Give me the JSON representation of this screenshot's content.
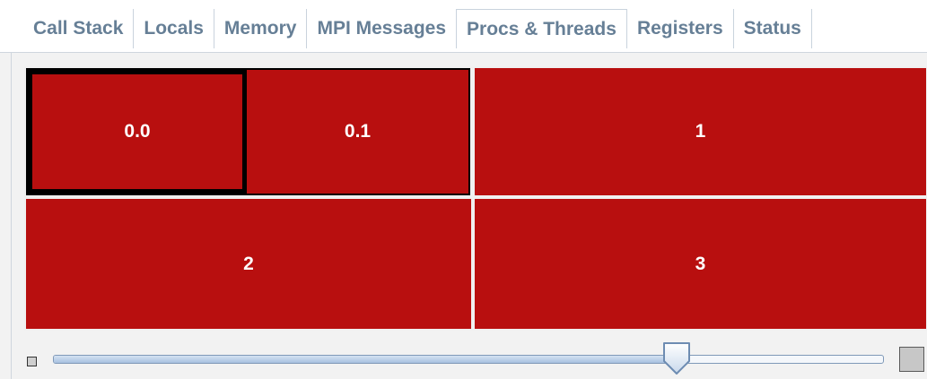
{
  "tabs": [
    {
      "label": "Call Stack",
      "active": false
    },
    {
      "label": "Locals",
      "active": false
    },
    {
      "label": "Memory",
      "active": false
    },
    {
      "label": "MPI Messages",
      "active": false
    },
    {
      "label": "Procs & Threads",
      "active": true
    },
    {
      "label": "Registers",
      "active": false
    },
    {
      "label": "Status",
      "active": false
    }
  ],
  "treemap": {
    "cells": [
      {
        "label": "0.0",
        "selected": true
      },
      {
        "label": "0.1"
      },
      {
        "label": "1"
      },
      {
        "label": "2"
      },
      {
        "label": "3"
      }
    ],
    "cell_color": "#b80f0f",
    "label_color": "#ffffff"
  },
  "zoom_slider": {
    "value_fraction": 0.75,
    "min_icon": "small-square-icon",
    "max_icon": "large-square-icon"
  },
  "colors": {
    "tab_text": "#667f96",
    "tab_border": "#c9d3dd",
    "selection_frame": "#000000",
    "slider_border": "#7f99b8"
  }
}
